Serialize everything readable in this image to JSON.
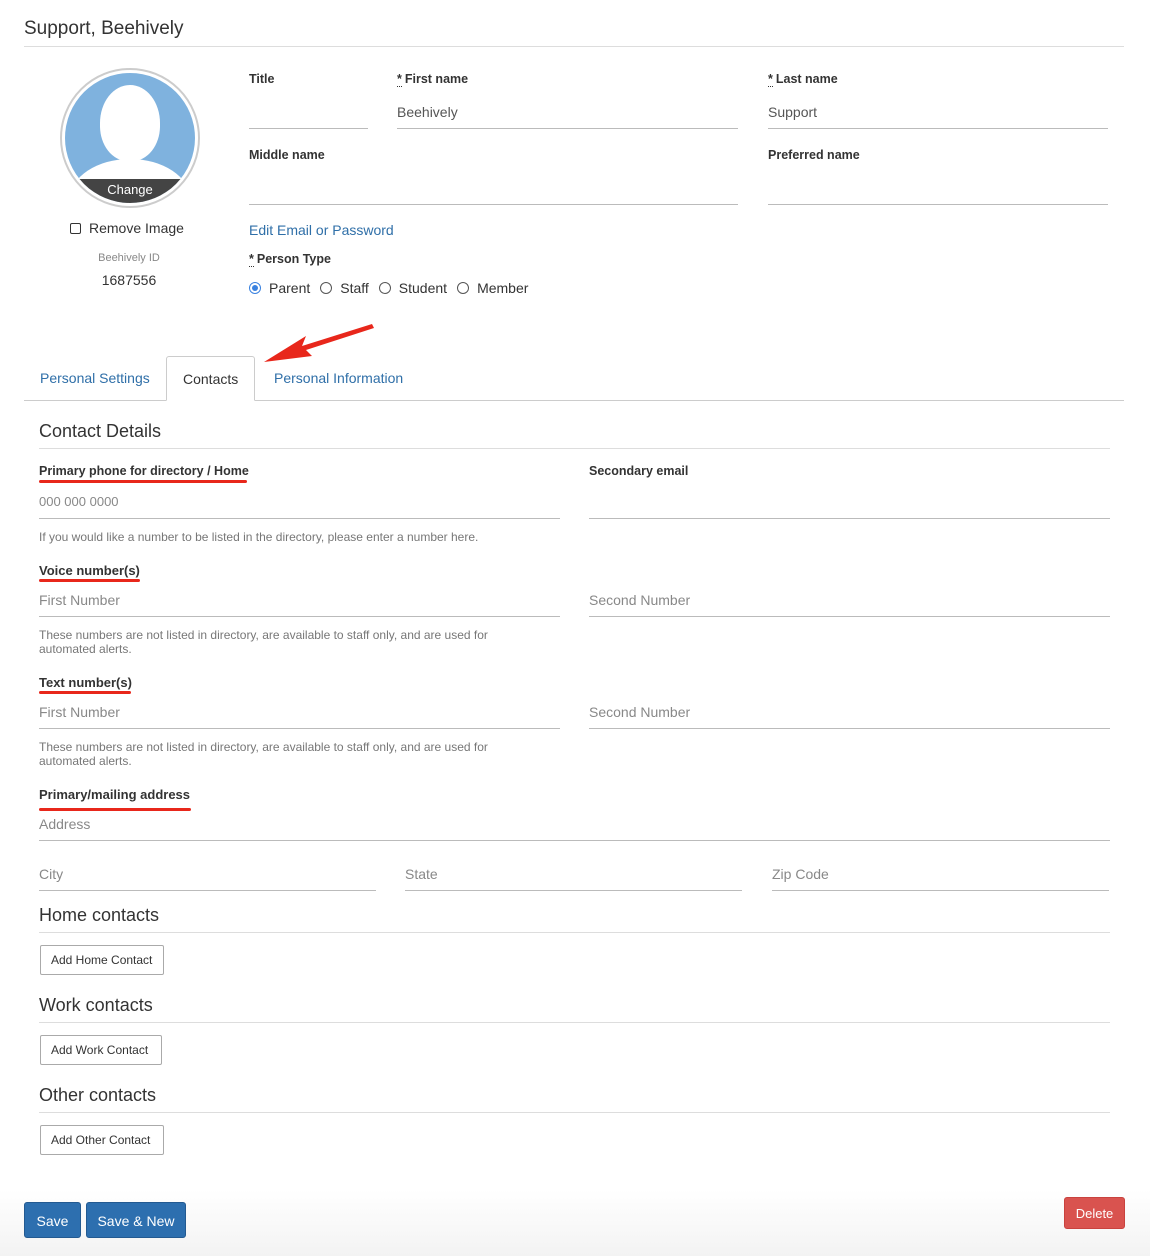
{
  "page": {
    "title": "Support, Beehively"
  },
  "avatar": {
    "change_label": "Change"
  },
  "remove_image": {
    "label": "Remove Image"
  },
  "beehively_id": {
    "label": "Beehively ID",
    "value": "1687556"
  },
  "fields": {
    "title": {
      "label": "Title",
      "value": ""
    },
    "first_name": {
      "required_mark": "*",
      "label": "First name",
      "value": "Beehively"
    },
    "last_name": {
      "required_mark": "*",
      "label": "Last name",
      "value": "Support"
    },
    "middle_name": {
      "label": "Middle name",
      "value": ""
    },
    "preferred_name": {
      "label": "Preferred name",
      "value": ""
    }
  },
  "edit_link": "Edit Email or Password",
  "person_type": {
    "required_mark": "*",
    "label": "Person Type",
    "options": [
      "Parent",
      "Staff",
      "Student",
      "Member"
    ],
    "selected": "Parent"
  },
  "tabs": [
    {
      "label": "Personal Settings",
      "active": false
    },
    {
      "label": "Contacts",
      "active": true
    },
    {
      "label": "Personal Information",
      "active": false
    }
  ],
  "contact_details": {
    "title": "Contact Details",
    "primary_phone": {
      "label": "Primary phone for directory / Home",
      "placeholder": "000 000 0000",
      "help": "If you would like a number to be listed in the directory, please enter a number here."
    },
    "secondary_email": {
      "label": "Secondary email",
      "value": ""
    },
    "voice": {
      "label": "Voice number(s)",
      "first_placeholder": "First Number",
      "second_placeholder": "Second Number",
      "help_line1": "These numbers are not listed in directory, are available to staff only, and are used for",
      "help_line2": "automated alerts."
    },
    "text": {
      "label": "Text number(s)",
      "first_placeholder": "First Number",
      "second_placeholder": "Second Number",
      "help_line1": "These numbers are not listed in directory, are available to staff only, and are used for",
      "help_line2": "automated alerts."
    },
    "address": {
      "label": "Primary/mailing address",
      "address_placeholder": "Address",
      "city_placeholder": "City",
      "state_placeholder": "State",
      "zip_placeholder": "Zip Code"
    }
  },
  "home_contacts": {
    "title": "Home contacts",
    "button": "Add Home Contact"
  },
  "work_contacts": {
    "title": "Work contacts",
    "button": "Add Work Contact"
  },
  "other_contacts": {
    "title": "Other contacts",
    "button": "Add Other Contact"
  },
  "actions": {
    "save": "Save",
    "save_new": "Save & New",
    "delete": "Delete"
  },
  "colors": {
    "link": "#2f6fa8",
    "primary_button": "#2d6faf",
    "danger_button": "#d9534f",
    "annotation_red": "#e8271b",
    "radio_selected": "#3a82e0"
  }
}
